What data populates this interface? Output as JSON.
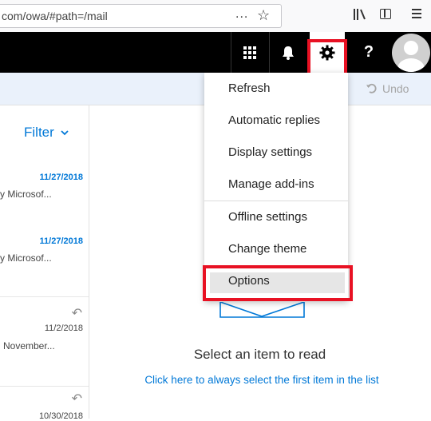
{
  "browser": {
    "url": "com/owa/#path=/mail",
    "more_icon": "...",
    "star_icon": "☆"
  },
  "header": {
    "help_label": "?",
    "icons": [
      "app-launcher-icon",
      "bell-icon",
      "gear-icon",
      "help-icon",
      "avatar"
    ]
  },
  "command_bar": {
    "undo_label": "Undo"
  },
  "message_list": {
    "filter_label": "Filter",
    "messages": [
      {
        "date": "11/27/2018",
        "snippet": "y Microsof...",
        "unread": true
      },
      {
        "date": "11/27/2018",
        "snippet": "y Microsof...",
        "unread": true
      },
      {
        "date": "11/2/2018",
        "snippet": "November...",
        "unread": false,
        "replied": true
      },
      {
        "date": "10/30/2018",
        "snippet": "",
        "unread": false,
        "replied": true
      }
    ]
  },
  "reading_pane": {
    "title": "Select an item to read",
    "link": "Click here to always select the first item in the list"
  },
  "settings_menu": {
    "items": [
      "Refresh",
      "Automatic replies",
      "Display settings",
      "Manage add-ins",
      "Offline settings",
      "Change theme",
      "Options"
    ],
    "selected": "Options"
  },
  "colors": {
    "accent": "#0078d7",
    "highlight": "#e81123",
    "header_bg": "#000000",
    "command_bar_bg": "#eaf1fb"
  }
}
